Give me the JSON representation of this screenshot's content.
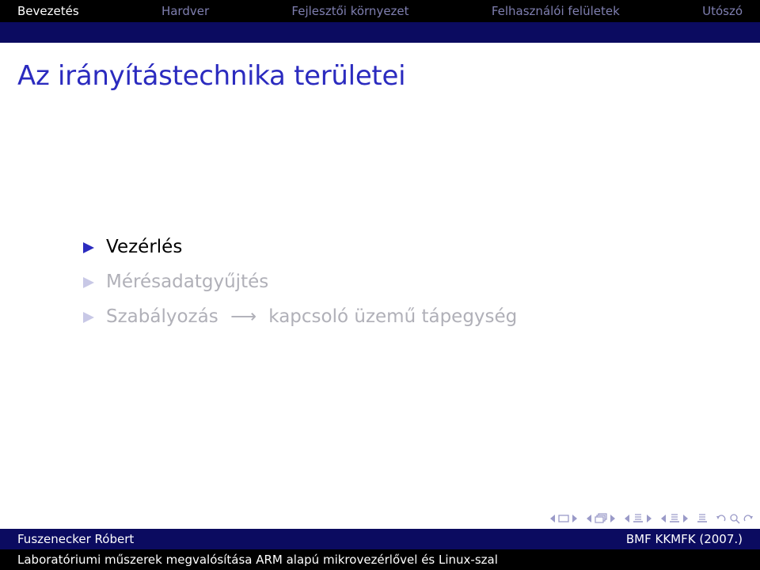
{
  "nav": {
    "sections": [
      "Bevezetés",
      "Hardver",
      "Fejlesztői környezet",
      "Felhasználói felületek",
      "Utószó"
    ],
    "active_index": 0
  },
  "frame": {
    "title": "Az irányítástechnika területei"
  },
  "bullets": [
    {
      "text": "Vezérlés",
      "state": "active"
    },
    {
      "text": "Mérésadatgyűjtés",
      "state": "faded"
    },
    {
      "text_before": "Szabályozás",
      "arrow": "⟶",
      "text_after": "kapcsoló üzemű tápegység",
      "state": "faded"
    }
  ],
  "footer": {
    "author": "Fuszenecker Róbert",
    "institute": "BMF KKMFK (2007.)",
    "talk_title": "Laboratóriumi műszerek megvalósítása ARM alapú mikrovezérlővel és Linux-szal"
  },
  "colors": {
    "title": "#2b2bbf",
    "bar_dark": "#0b0b60",
    "bar_black": "#000000",
    "bullet_marker": "#2b2bbf",
    "faded_text": "#b0b0b8",
    "nav_inactive": "#7f7fb0",
    "nav_symbols": "#9a9ac8"
  },
  "icons": [
    "bullet-triangle-icon",
    "nav-left-arrow-icon",
    "nav-frame-icon",
    "nav-right-arrow-icon",
    "nav-subsection-icon",
    "nav-section-icon",
    "nav-presentation-icon",
    "nav-back-icon",
    "nav-search-icon",
    "nav-forward-icon"
  ]
}
